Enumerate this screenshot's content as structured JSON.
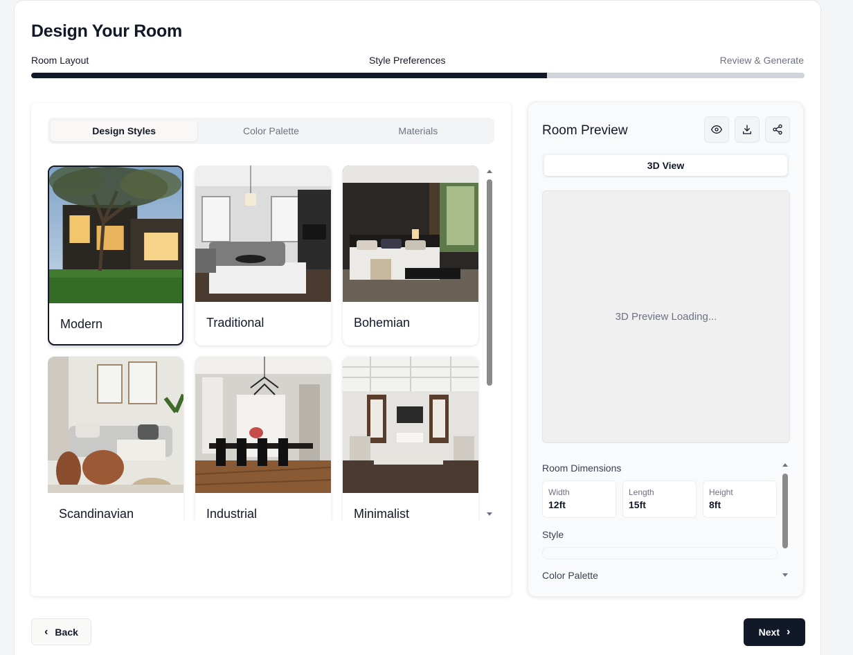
{
  "header": {
    "title": "Design Your Room",
    "steps": [
      "Room Layout",
      "Style Preferences",
      "Review & Generate"
    ],
    "progress_percent": 66.7
  },
  "left_panel": {
    "tabs": [
      "Design Styles",
      "Color Palette",
      "Materials"
    ],
    "active_tab": "Design Styles",
    "styles": [
      {
        "label": "Modern",
        "selected": true
      },
      {
        "label": "Traditional",
        "selected": false
      },
      {
        "label": "Bohemian",
        "selected": false
      },
      {
        "label": "Scandinavian",
        "selected": false
      },
      {
        "label": "Industrial",
        "selected": false
      },
      {
        "label": "Minimalist",
        "selected": false
      }
    ]
  },
  "right_panel": {
    "title": "Room Preview",
    "icons": [
      "eye-icon",
      "download-icon",
      "share-icon"
    ],
    "view_tab": "3D View",
    "preview_text": "3D Preview Loading...",
    "dimensions_label": "Room Dimensions",
    "dimensions": [
      {
        "name": "Width",
        "value": "12ft"
      },
      {
        "name": "Length",
        "value": "15ft"
      },
      {
        "name": "Height",
        "value": "8ft"
      }
    ],
    "style_label": "Style",
    "color_palette_label": "Color Palette"
  },
  "footer": {
    "back_label": "Back",
    "next_label": "Next"
  },
  "colors": {
    "primary": "#111827",
    "progress_track": "#d1d5db",
    "muted_text": "#6b7280"
  }
}
